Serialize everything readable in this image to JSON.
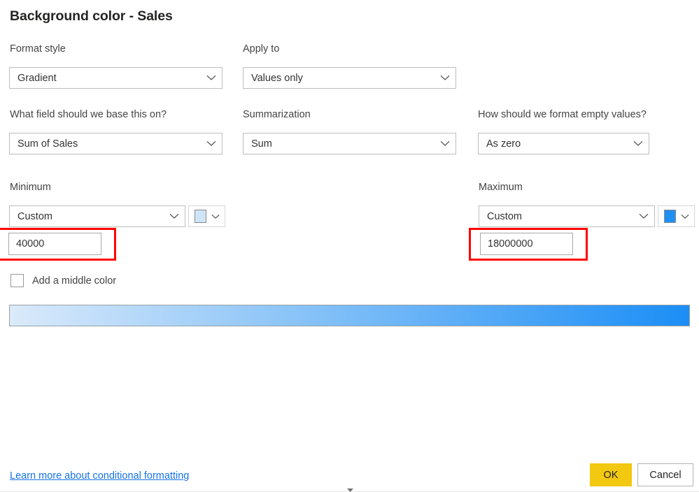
{
  "dialog": {
    "title": "Background color - Sales"
  },
  "fields": {
    "format_style": {
      "label": "Format style",
      "value": "Gradient",
      "chevron_icon": "chevron-down-icon"
    },
    "apply_to": {
      "label": "Apply to",
      "value": "Values only",
      "chevron_icon": "chevron-down-icon"
    },
    "base_field": {
      "label": "What field should we base this on?",
      "value": "Sum of Sales",
      "chevron_icon": "chevron-down-icon"
    },
    "summarization": {
      "label": "Summarization",
      "value": "Sum",
      "chevron_icon": "chevron-down-icon"
    },
    "empty_values": {
      "label": "How should we format empty values?",
      "value": "As zero",
      "chevron_icon": "chevron-down-icon"
    }
  },
  "minimum": {
    "label": "Minimum",
    "mode": "Custom",
    "value": "40000",
    "color": "#cfe4f7",
    "chevron_icon": "chevron-down-icon",
    "color_chevron_icon": "chevron-down-icon",
    "highlighted": true
  },
  "maximum": {
    "label": "Maximum",
    "mode": "Custom",
    "value": "18000000",
    "color": "#1f91f3",
    "chevron_icon": "chevron-down-icon",
    "color_chevron_icon": "chevron-down-icon",
    "highlighted": true
  },
  "middle_color": {
    "label": "Add a middle color",
    "checked": false
  },
  "gradient_preview": {
    "start_color": "#daeafa",
    "end_color": "#1b8ef5"
  },
  "footer": {
    "learn_more_label": "Learn more about conditional formatting",
    "ok_label": "OK",
    "cancel_label": "Cancel",
    "ok_color": "#f2c811"
  }
}
